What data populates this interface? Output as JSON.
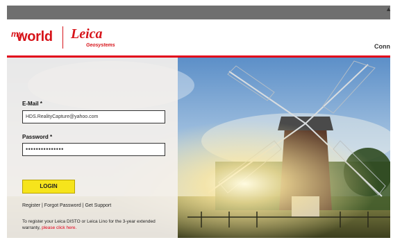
{
  "header": {
    "logo_my": "my",
    "logo_world": "world",
    "logo_leica": "Leica",
    "logo_geosystems": "Geosystems",
    "nav_partial": "Conn"
  },
  "form": {
    "email_label": "E-Mail *",
    "email_value": "HDS.RealityCapture@yahoo.com",
    "password_label": "Password *",
    "password_value": "•••••••••••••••",
    "login_label": "LOGIN",
    "link_register": "Register",
    "link_forgot": "Forgot Password",
    "link_support": "Get Support",
    "info_text": "To register your Leica DISTO or Leica Lino for the 3-year extended warranty,",
    "info_link": "please click here."
  },
  "colors": {
    "brand_red": "#e2001a",
    "button_yellow": "#f6e41c"
  }
}
